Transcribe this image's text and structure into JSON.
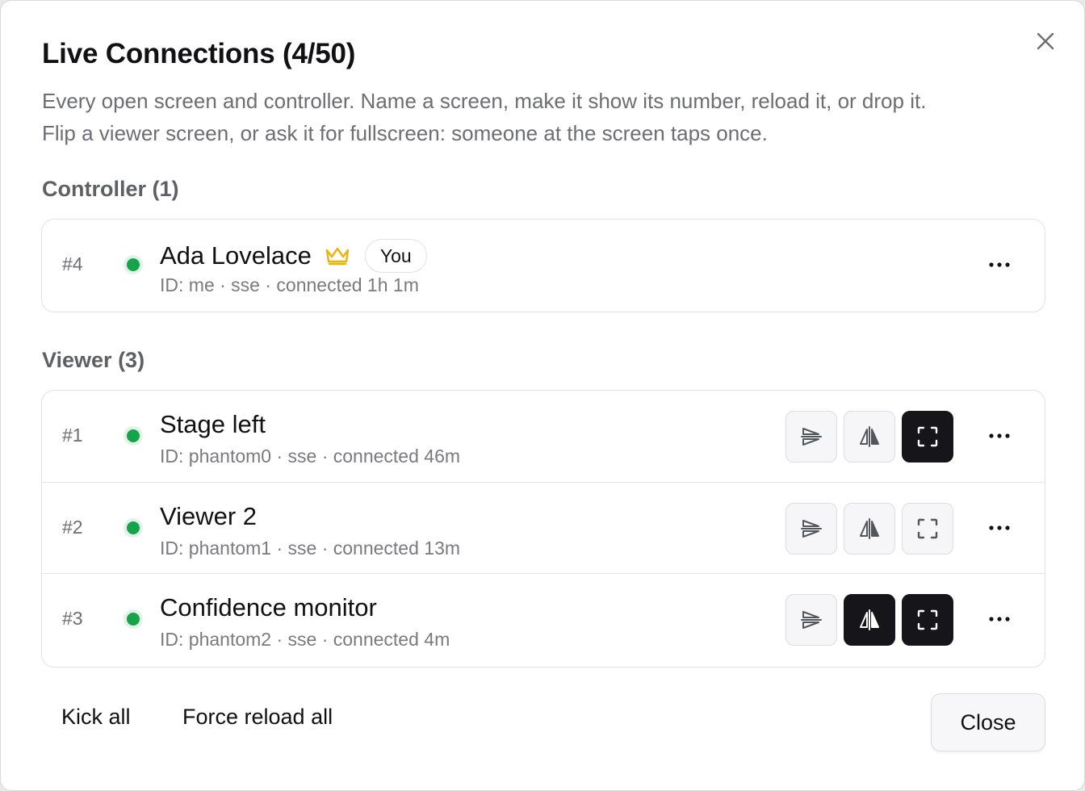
{
  "dialog": {
    "title": "Live Connections (4/50)",
    "description_line1": "Every open screen and controller. Name a screen, make it show its number, reload it, or drop it.",
    "description_line2": "Flip a viewer screen, or ask it for fullscreen: someone at the screen taps once.",
    "close_icon": "close-icon"
  },
  "colors": {
    "online_dot": "#16a34a",
    "crown": "#eab308",
    "active_tool_bg": "#15151a",
    "muted_text": "#6d6d74"
  },
  "controller": {
    "label": "Controller (1)",
    "rows": [
      {
        "number": "#4",
        "name": "Ada Lovelace",
        "badge": "You",
        "crown_icon": "crown-icon",
        "meta": "ID: me · sse · connected 1h 1m",
        "status": "online"
      }
    ]
  },
  "viewers": {
    "label": "Viewer (3)",
    "rows": [
      {
        "number": "#1",
        "name": "Stage left",
        "meta": "ID: phantom0 · sse · connected 46m",
        "status": "online",
        "flip_vertical_active": false,
        "mirror_active": false,
        "fullscreen_active": true
      },
      {
        "number": "#2",
        "name": "Viewer 2",
        "meta": "ID: phantom1 · sse · connected 13m",
        "status": "online",
        "flip_vertical_active": false,
        "mirror_active": false,
        "fullscreen_active": false
      },
      {
        "number": "#3",
        "name": "Confidence monitor",
        "meta": "ID: phantom2 · sse · connected 4m",
        "status": "online",
        "flip_vertical_active": false,
        "mirror_active": true,
        "fullscreen_active": true
      }
    ]
  },
  "icons": {
    "flip_vertical": "flip-vertical-icon",
    "mirror": "mirror-horizontal-icon",
    "fullscreen": "fullscreen-icon",
    "more": "more-horizontal-icon"
  },
  "footer": {
    "kick_all": "Kick all",
    "force_reload_all": "Force reload all",
    "close": "Close"
  }
}
